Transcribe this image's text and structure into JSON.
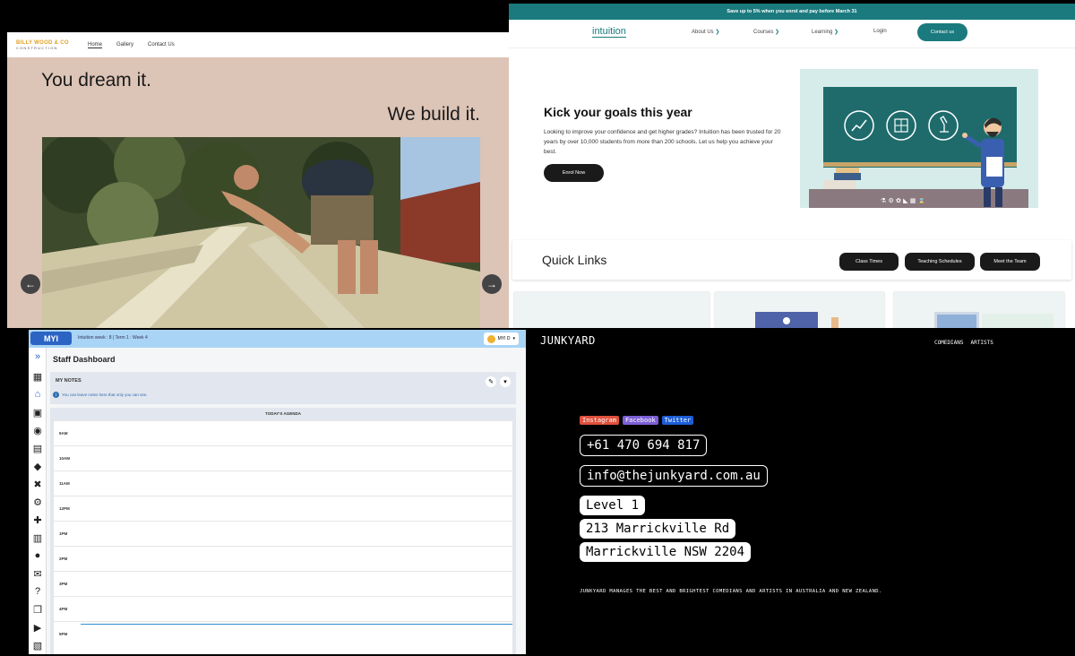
{
  "construction": {
    "logo_top": "BILLY WOOD & CO",
    "logo_bottom": "CONSTRUCTION",
    "nav": [
      "Home",
      "Gallery",
      "Contact Us"
    ],
    "headline_1": "You dream it.",
    "headline_2": "We build it.",
    "prev_arrow": "←",
    "next_arrow": "→"
  },
  "intuition": {
    "promo": "Save up to 5% when you enrol and pay before March 31",
    "brand": "intuition",
    "nav": [
      "About Us",
      "Courses",
      "Learning",
      "Login"
    ],
    "contact_button": "Contact us",
    "hero_title": "Kick your goals this year",
    "hero_text": "Looking to improve your confidence and get higher grades? Intuition has been trusted for 20 years by over 10,000 students from more than 200 schools. Let us help you achieve your best.",
    "enrol_button": "Enrol Now",
    "quick_links_title": "Quick Links",
    "quick_links": [
      "Class Times",
      "Teaching Schedules",
      "Meet the Team"
    ],
    "accent_color": "#1b7a7e"
  },
  "dashboard": {
    "logo": "MYI",
    "term_info": "Intuition week : 8  |  Term 1 : Week 4",
    "user": "MYI D",
    "page_title": "Staff Dashboard",
    "notes_title": "MY NOTES",
    "notes_info": "You can leave notes here that only you can see.",
    "agenda_title": "TODAY'S AGENDA",
    "hours": [
      "9AM",
      "10AM",
      "11AM",
      "12PM",
      "1PM",
      "2PM",
      "3PM",
      "4PM",
      "5PM"
    ]
  },
  "junkyard": {
    "brand": "JUNKYARD",
    "menu": [
      "COMEDIANS",
      "ARTISTS"
    ],
    "socials": [
      {
        "label": "Instagram",
        "color": "#e0503c"
      },
      {
        "label": "Facebook",
        "color": "#7b5fd6"
      },
      {
        "label": "Twitter",
        "color": "#1d5ed8"
      }
    ],
    "phone": "+61 470 694 817",
    "email": "info@thejunkyard.com.au",
    "address_1": "Level 1",
    "address_2": "213 Marrickville Rd",
    "address_3": "Marrickville NSW 2204",
    "tagline": "JUNKYARD MANAGES THE BEST AND BRIGHTEST COMEDIANS AND ARTISTS IN AUSTRALIA AND NEW ZEALAND."
  }
}
